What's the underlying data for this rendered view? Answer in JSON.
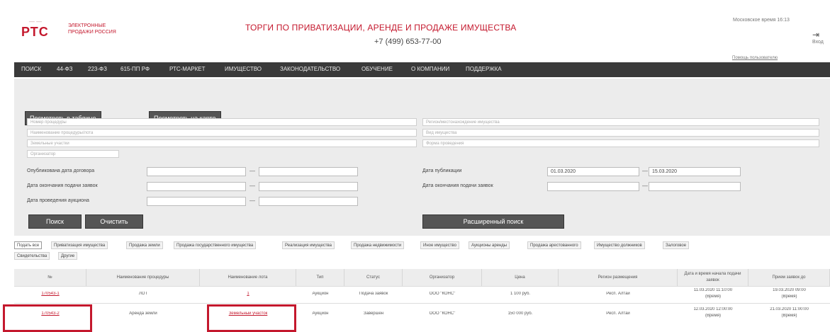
{
  "header": {
    "logo": "РТС",
    "logo_top": "— —",
    "logo_caption": "ЭЛЕКТРОННЫЕ ПРОДАЖИ РОССИЯ",
    "title": "ТОРГИ ПО ПРИВАТИЗАЦИИ, АРЕНДЕ И ПРОДАЖЕ ИМУЩЕСТВА",
    "phone": "+7 (499) 653-77-00",
    "top_right": "Московское время 16:13",
    "login": "Вход",
    "link": "Помощь пользователю"
  },
  "nav": [
    "ПОИСК",
    "44-ФЗ",
    "223-ФЗ",
    "615-ПП РФ",
    "РТС-МАРКЕТ",
    "ИМУЩЕСТВО",
    "ЗАКОНОДАТЕЛЬСТВО",
    "ОБУЧЕНИЕ",
    "О КОМПАНИИ",
    "ПОДДЕРЖКА"
  ],
  "form": {
    "view_table": "Посмотреть в таблице",
    "view_map": "Посмотреть на карте",
    "placeholders": {
      "left1": "Номер процедуры",
      "left2": "Наименование процедуры/лота",
      "left3": "Земельные участки",
      "left4": "Организатор",
      "right1": "Регион/местонахождение имущества",
      "right2": "Вид имущества",
      "right3": "Форма проведения"
    },
    "labels": {
      "pub_date": "Опубликована дата договора",
      "app_end": "Дата окончания подачи заявок",
      "auction": "Дата проведения аукциона",
      "pub_right": "Дата публикации",
      "app_right": "Дата окончания подачи заявок"
    },
    "date_from": "01.03.2020",
    "date_to": "15.03.2020",
    "search": "Поиск",
    "reset": "Очистить",
    "advanced": "Расширенный поиск"
  },
  "tabs": [
    "Подать все",
    "Приватизация имущества",
    "Продажа земли",
    "Продажа государственного имущества",
    "Реализация имущества",
    "Продажа недвижимости",
    "Иное имущество",
    "Аукционы аренды",
    "Продажа арестованного",
    "Имущество должников",
    "Залоговое",
    "Свидетельства",
    "Другие"
  ],
  "table": {
    "headers": [
      "№",
      "Наименование процедуры",
      "Наименование лота",
      "Тип",
      "Статус",
      "Организатор",
      "Цена",
      "Регион размещения",
      "Дата и время начала подачи заявок",
      "Прием заявок до"
    ],
    "rows": [
      {
        "num": "170543-1",
        "name": "ЛОТ",
        "lot": "1",
        "type": "Аукцион",
        "status": "Подача заявок",
        "org": "ООО \"КОНС\"",
        "price": "1 100 руб.",
        "region": "Респ. Алтай",
        "start": "11.03.2020 11:10:00",
        "start_sub": "(Время)",
        "end": "19.03.2020 09:00",
        "end_sub": "(Время)"
      },
      {
        "num": "170543-2",
        "name": "Аренда земли",
        "lot": "Земельный участок",
        "type": "Аукцион",
        "status": "Завершен",
        "org": "ООО \"КОНС\"",
        "price": "150 000 руб.",
        "region": "Респ. Алтай",
        "start": "12.03.2020 12:00:00",
        "start_sub": "(Время)",
        "end": "21.03.2020 11:00:00",
        "end_sub": "(Время)"
      }
    ]
  }
}
